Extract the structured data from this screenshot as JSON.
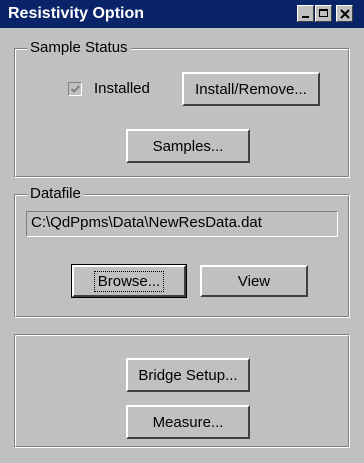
{
  "window": {
    "title": "Resistivity Option",
    "controls": {
      "minimize": "minimize-icon",
      "maximize": "maximize-icon",
      "close": "close-icon"
    }
  },
  "sample_status": {
    "label": "Sample Status",
    "installed_label": "Installed",
    "installed_checked": true,
    "install_remove_button": "Install/Remove...",
    "samples_button": "Samples..."
  },
  "datafile": {
    "label": "Datafile",
    "path": "C:\\QdPpms\\Data\\NewResData.dat",
    "browse_button": "Browse...",
    "view_button": "View"
  },
  "actions": {
    "bridge_setup_button": "Bridge Setup...",
    "measure_button": "Measure..."
  }
}
